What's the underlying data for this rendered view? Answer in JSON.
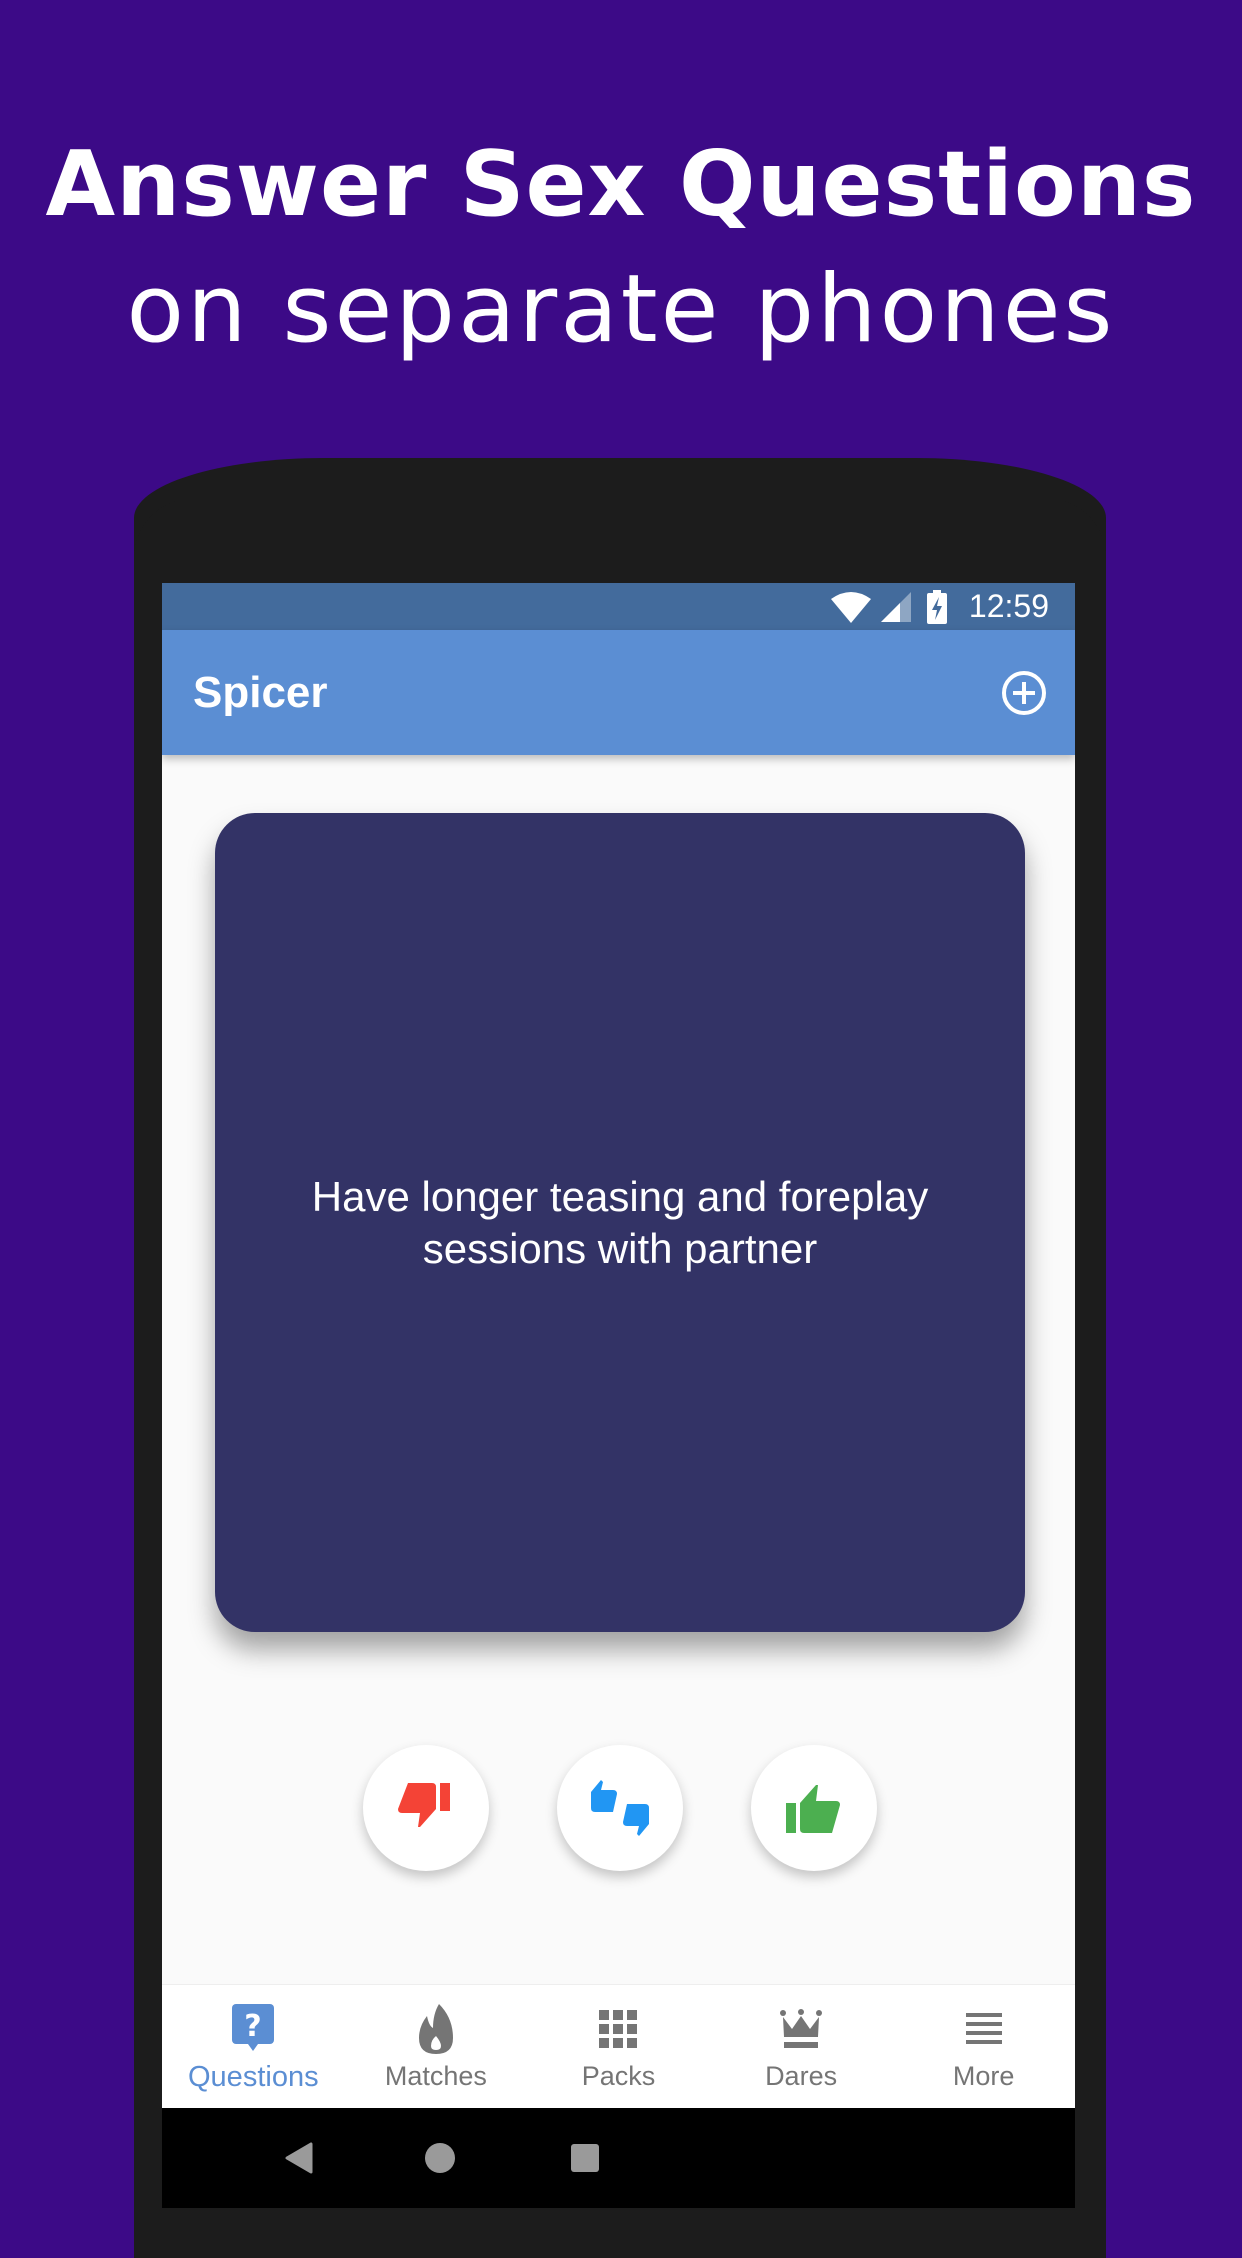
{
  "promo": {
    "headline": "Answer Sex Questions",
    "subheadline": "on separate phones"
  },
  "status_bar": {
    "time": "12:59",
    "icons": [
      "wifi-icon",
      "cell-signal-icon",
      "battery-charging-icon"
    ]
  },
  "app_bar": {
    "title": "Spicer",
    "action_icon": "add-circle-icon"
  },
  "question_card": {
    "text": "Have longer teasing and foreplay sessions with partner"
  },
  "vote_buttons": [
    {
      "name": "dislike",
      "icon": "thumbs-down-icon",
      "color": "#f44336"
    },
    {
      "name": "maybe",
      "icon": "thumbs-mixed-icon",
      "color": "#2196f3"
    },
    {
      "name": "like",
      "icon": "thumbs-up-icon",
      "color": "#4caf50"
    }
  ],
  "bottom_tabs": [
    {
      "label": "Questions",
      "icon": "question-bubble-icon",
      "active": true
    },
    {
      "label": "Matches",
      "icon": "flame-icon",
      "active": false
    },
    {
      "label": "Packs",
      "icon": "grid-icon",
      "active": false
    },
    {
      "label": "Dares",
      "icon": "crown-icon",
      "active": false
    },
    {
      "label": "More",
      "icon": "menu-icon",
      "active": false
    }
  ],
  "nav_bar": [
    "back",
    "home",
    "recents"
  ],
  "colors": {
    "background": "#3c0a87",
    "app_bar": "#5b8ed3",
    "status_bar": "#436b9c",
    "card": "#333366",
    "accent": "#5b8ed3",
    "inactive": "#757575"
  }
}
